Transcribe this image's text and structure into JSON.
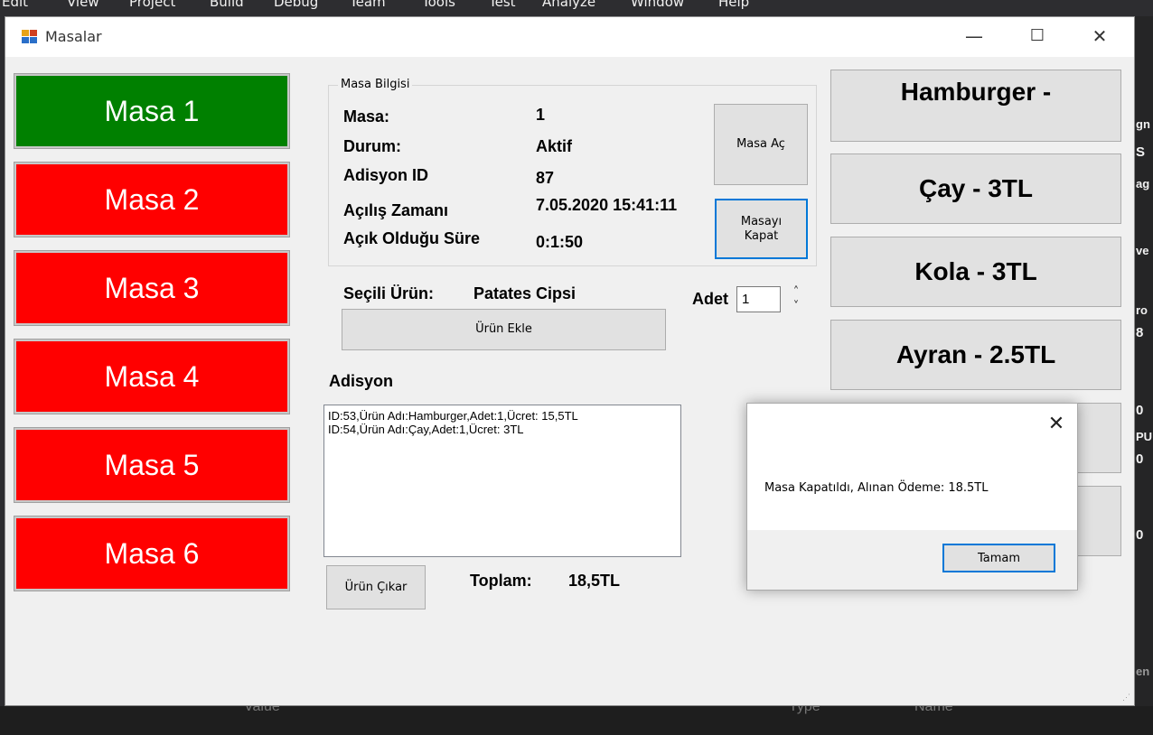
{
  "ide": {
    "menu": [
      "Edit",
      "View",
      "Project",
      "Build",
      "Debug",
      "Team",
      "Tools",
      "Test",
      "Analyze",
      "Window",
      "Help"
    ],
    "right_fragments": [
      "gn",
      "S",
      "ag",
      "ve",
      "ro",
      "8",
      "0",
      "PU",
      "0",
      "0",
      "en"
    ],
    "bottom_fragments": [
      "Value",
      "Type",
      "Name"
    ]
  },
  "window": {
    "title": "Masalar",
    "minimize": "—",
    "maximize": "☐",
    "close": "✕"
  },
  "tables": [
    {
      "label": "Masa 1",
      "color": "#008000"
    },
    {
      "label": "Masa 2",
      "color": "#ff0000"
    },
    {
      "label": "Masa 3",
      "color": "#ff0000"
    },
    {
      "label": "Masa 4",
      "color": "#ff0000"
    },
    {
      "label": "Masa 5",
      "color": "#ff0000"
    },
    {
      "label": "Masa 6",
      "color": "#ff0000"
    }
  ],
  "info": {
    "group_title": "Masa Bilgisi",
    "masa_label": "Masa:",
    "masa_value": "1",
    "durum_label": "Durum:",
    "durum_value": "Aktif",
    "adisyon_id_label": "Adisyon ID",
    "adisyon_id_value": "87",
    "acilis_label": "Açılış Zamanı",
    "acilis_value": "7.05.2020 15:41:11",
    "acik_sure_label": "Açık Olduğu Süre",
    "acik_sure_value": "0:1:50",
    "masa_ac_button": "Masa Aç",
    "masayi_kapat_button": "Masayı Kapat"
  },
  "order": {
    "secili_label": "Seçili Ürün:",
    "secili_value": "Patates Cipsi",
    "adet_label": "Adet",
    "adet_value": "1",
    "spin_up": "˄",
    "spin_down": "˅",
    "urun_ekle_button": "Ürün Ekle",
    "adisyon_label": "Adisyon",
    "adisyon_items": [
      "ID:53,Ürün Adı:Hamburger,Adet:1,Ücret: 15,5TL",
      "ID:54,Ürün Adı:Çay,Adet:1,Ücret: 3TL"
    ],
    "urun_cikar_button": "Ürün Çıkar",
    "toplam_label": "Toplam:",
    "toplam_value": "18,5TL"
  },
  "menu_items": [
    "Hamburger -",
    "Çay - 3TL",
    "Kola - 3TL",
    "Ayran - 2.5TL",
    "-",
    ""
  ],
  "dialog": {
    "close": "✕",
    "message": "Masa Kapatıldı, Alınan Ödeme: 18.5TL",
    "ok_button": "Tamam"
  }
}
